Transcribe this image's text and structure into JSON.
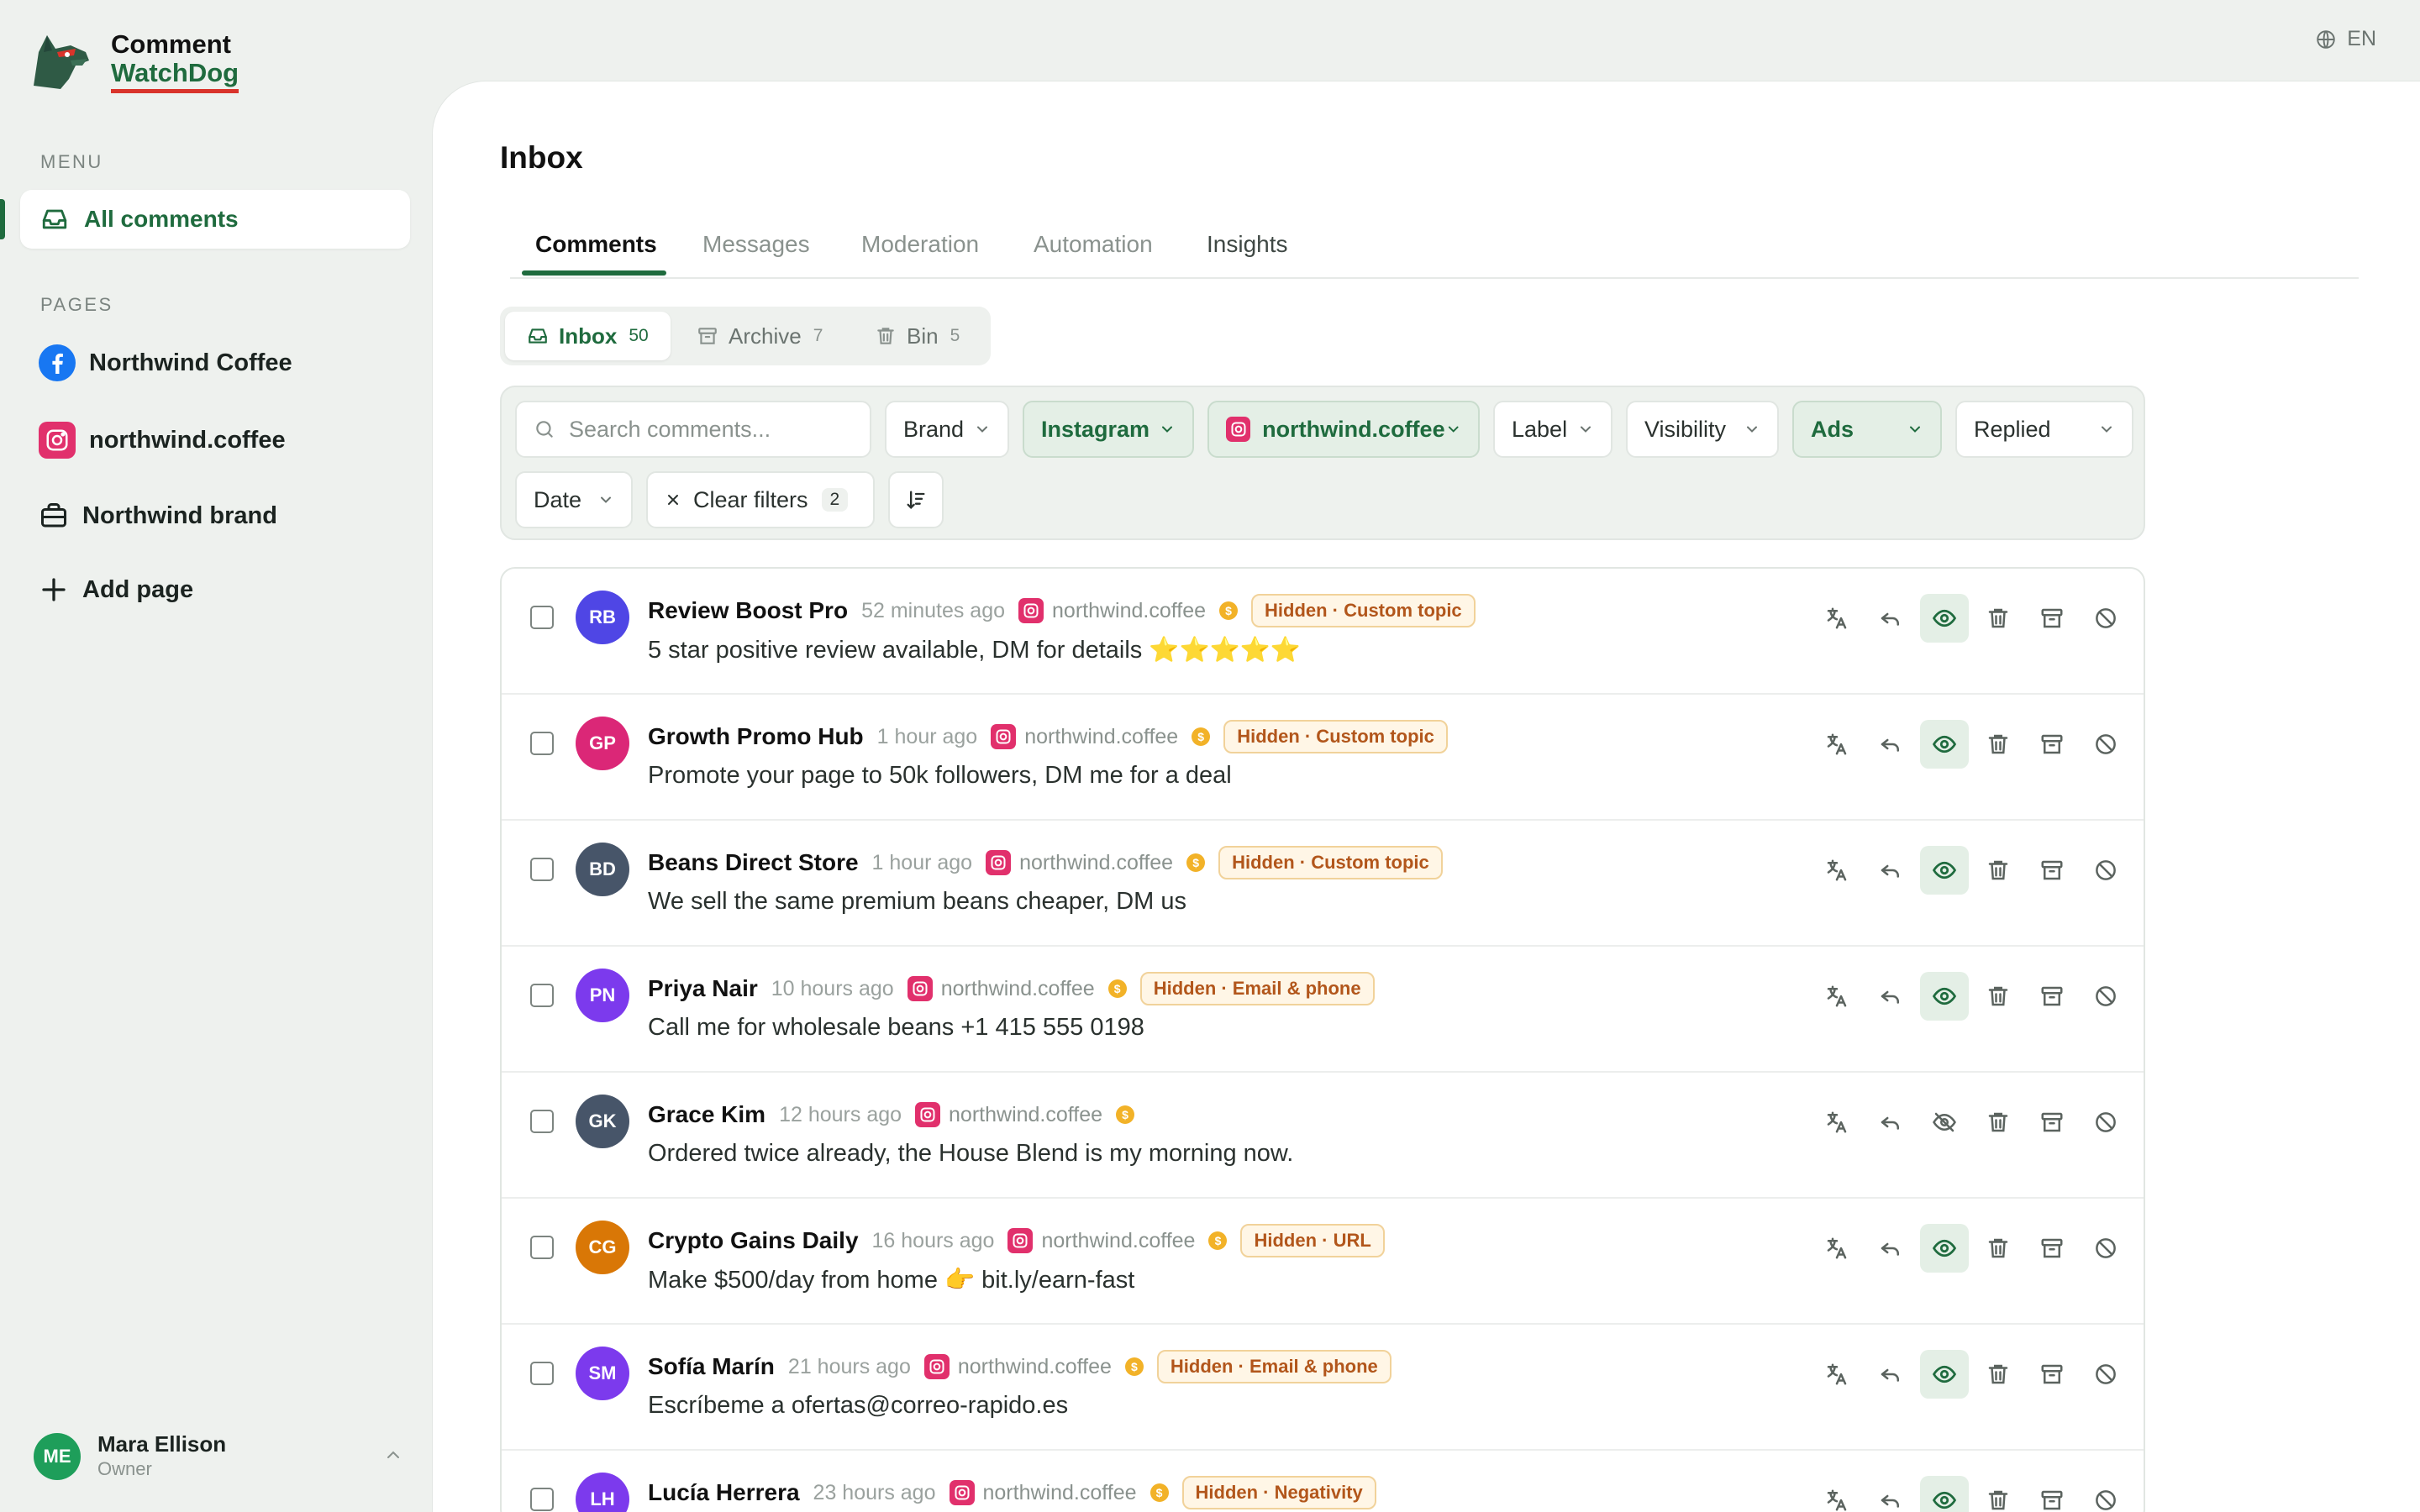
{
  "app": {
    "name_line1": "Comment",
    "name_line2": "WatchDog",
    "language": "EN"
  },
  "sidebar": {
    "menu_label": "MENU",
    "menu_items": [
      {
        "label": "All comments",
        "icon": "inbox-icon"
      }
    ],
    "pages_label": "PAGES",
    "pages": [
      {
        "label": "Northwind Coffee",
        "icon": "facebook-icon"
      },
      {
        "label": "northwind.coffee",
        "icon": "instagram-icon"
      },
      {
        "label": "Northwind brand",
        "icon": "briefcase-icon"
      }
    ],
    "add_page_label": "Add page"
  },
  "user": {
    "initials": "ME",
    "name": "Mara Ellison",
    "role": "Owner"
  },
  "main": {
    "title": "Inbox",
    "tabs": [
      {
        "label": "Comments",
        "active": true
      },
      {
        "label": "Messages"
      },
      {
        "label": "Moderation"
      },
      {
        "label": "Automation"
      },
      {
        "label": "Insights"
      }
    ],
    "folders": [
      {
        "label": "Inbox",
        "count": "50",
        "active": true
      },
      {
        "label": "Archive",
        "count": "7"
      },
      {
        "label": "Bin",
        "count": "5"
      }
    ]
  },
  "filters": {
    "search_placeholder": "Search comments...",
    "brand": "Brand",
    "network": "Instagram",
    "page": "northwind.coffee",
    "label": "Label",
    "visibility": "Visibility",
    "ads": "Ads",
    "replied": "Replied",
    "date": "Date",
    "clear_label": "Clear filters",
    "clear_count": "2"
  },
  "comments": [
    {
      "initials": "RB",
      "color": "#4f46e5",
      "author": "Review Boost Pro",
      "time": "52 minutes ago",
      "page": "northwind.coffee",
      "status": "Hidden · Custom topic",
      "text": "5 star positive review available, DM for details ⭐⭐⭐⭐⭐",
      "hidden": true
    },
    {
      "initials": "GP",
      "color": "#db2777",
      "author": "Growth Promo Hub",
      "time": "1 hour ago",
      "page": "northwind.coffee",
      "status": "Hidden · Custom topic",
      "text": "Promote your page to 50k followers, DM me for a deal",
      "hidden": true
    },
    {
      "initials": "BD",
      "color": "#475569",
      "author": "Beans Direct Store",
      "time": "1 hour ago",
      "page": "northwind.coffee",
      "status": "Hidden · Custom topic",
      "text": "We sell the same premium beans cheaper, DM us",
      "hidden": true
    },
    {
      "initials": "PN",
      "color": "#7c3aed",
      "author": "Priya Nair",
      "time": "10 hours ago",
      "page": "northwind.coffee",
      "status": "Hidden · Email & phone",
      "text": "Call me for wholesale beans +1 415 555 0198",
      "hidden": true
    },
    {
      "initials": "GK",
      "color": "#475569",
      "author": "Grace Kim",
      "time": "12 hours ago",
      "page": "northwind.coffee",
      "status": "",
      "text": "Ordered twice already, the House Blend is my morning now.",
      "hidden": false
    },
    {
      "initials": "CG",
      "color": "#d97706",
      "author": "Crypto Gains Daily",
      "time": "16 hours ago",
      "page": "northwind.coffee",
      "status": "Hidden · URL",
      "text": "Make $500/day from home 👉 bit.ly/earn-fast",
      "hidden": true
    },
    {
      "initials": "SM",
      "color": "#7c3aed",
      "author": "Sofía Marín",
      "time": "21 hours ago",
      "page": "northwind.coffee",
      "status": "Hidden · Email & phone",
      "text": "Escríbeme a ofertas@correo-rapido.es",
      "hidden": true
    },
    {
      "initials": "LH",
      "color": "#7c3aed",
      "author": "Lucía Herrera",
      "time": "23 hours ago",
      "page": "northwind.coffee",
      "status": "Hidden · Negativity",
      "text": "",
      "hidden": true
    }
  ],
  "colors": {
    "accent": "#1f6b3e",
    "danger_underline": "#d9342b",
    "instagram": "#e1306c",
    "facebook": "#1877f2",
    "status_text": "#b2561b"
  }
}
